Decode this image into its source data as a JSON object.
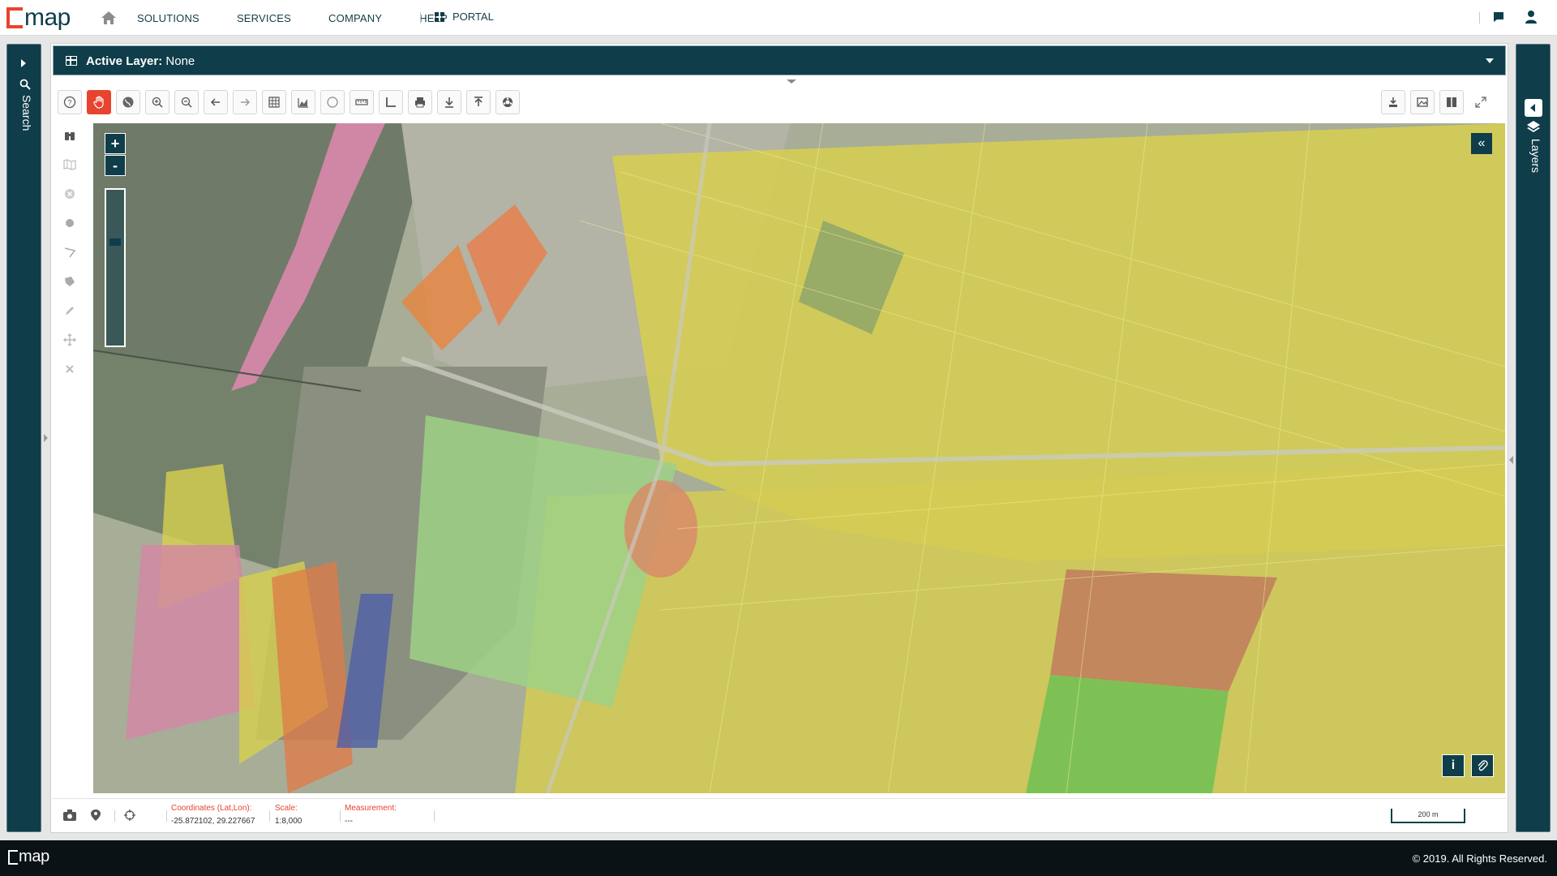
{
  "brand": {
    "logo_text": "map",
    "accent": "#e8432e",
    "primary": "#0f3d4a"
  },
  "nav": {
    "links": [
      "SOLUTIONS",
      "SERVICES",
      "COMPANY",
      "HELP"
    ],
    "portal": "PORTAL"
  },
  "search_panel": {
    "label": "Search"
  },
  "layers_panel": {
    "label": "Layers"
  },
  "layer_bar": {
    "prefix": "Active Layer:",
    "value": "None"
  },
  "toolbar": {
    "tools": [
      "help-icon",
      "pan-hand-icon",
      "globe-icon",
      "zoom-in-icon",
      "zoom-out-icon",
      "back-arrow-icon",
      "forward-arrow-icon",
      "table-icon",
      "chart-icon",
      "circle-icon",
      "ruler-icon",
      "angle-icon",
      "print-icon",
      "download-icon",
      "upload-icon",
      "settings-icon"
    ],
    "right_tools": [
      "export-download-icon",
      "image-icon",
      "split-view-icon",
      "fullscreen-icon"
    ]
  },
  "vertical_tools": [
    "binoculars-icon",
    "map-icon",
    "clear-icon",
    "point-icon",
    "polyline-icon",
    "polygon-icon",
    "edit-icon",
    "move-icon",
    "delete-icon"
  ],
  "map": {
    "zoom_in": "+",
    "zoom_out": "-",
    "collapse": "«",
    "info": "i",
    "zoom_level": 0.32
  },
  "status": {
    "coordinates_label": "Coordinates (Lat,Lon):",
    "coordinates_value": "-25.872102, 29.227667",
    "scale_label": "Scale:",
    "scale_value": "1:8,000",
    "measurement_label": "Measurement:",
    "measurement_value": "---",
    "scalebar_text": "200 m"
  },
  "footer": {
    "logo_text": "map",
    "copyright": "© 2019. All Rights Reserved."
  }
}
